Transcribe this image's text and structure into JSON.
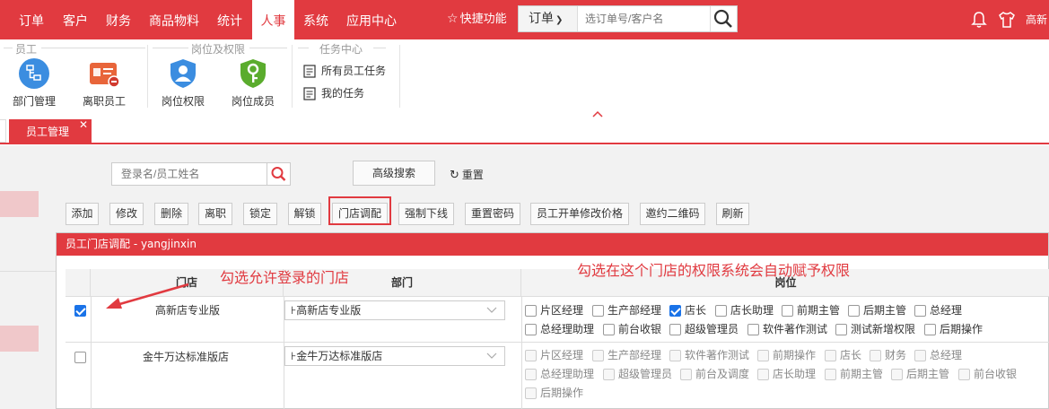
{
  "topnav": {
    "items": [
      {
        "label": "订单",
        "active": false
      },
      {
        "label": "客户",
        "active": false
      },
      {
        "label": "财务",
        "active": false
      },
      {
        "label": "商品物料",
        "active": false
      },
      {
        "label": "统计",
        "active": false
      },
      {
        "label": "人事",
        "active": true
      },
      {
        "label": "系统",
        "active": false
      },
      {
        "label": "应用中心",
        "active": false
      }
    ],
    "quick_label": "快捷功能",
    "search_scope": "订单",
    "search_placeholder": "选订单号/客户名",
    "user_name": "高新"
  },
  "ribbon": {
    "groups": [
      {
        "title": "员工",
        "buttons": [
          {
            "label": "部门管理",
            "icon": "org-chart-icon"
          },
          {
            "label": "离职员工",
            "icon": "resign-card-icon"
          }
        ]
      },
      {
        "title": "岗位及权限",
        "buttons": [
          {
            "label": "岗位权限",
            "icon": "user-shield-icon"
          },
          {
            "label": "岗位成员",
            "icon": "key-shield-icon"
          }
        ]
      },
      {
        "title": "任务中心",
        "items": [
          {
            "label": "所有员工任务"
          },
          {
            "label": "我的任务"
          }
        ]
      }
    ]
  },
  "tabs": [
    {
      "label": "员工管理",
      "active": true
    }
  ],
  "filter": {
    "name_placeholder": "登录名/员工姓名",
    "advanced_label": "高级搜索",
    "reset_label": "重置"
  },
  "toolbar": [
    "添加",
    "修改",
    "删除",
    "离职",
    "锁定",
    "解锁",
    "门店调配",
    "强制下线",
    "重置密码",
    "员工开单修改价格",
    "邀约二维码",
    "刷新"
  ],
  "dialog": {
    "title": "员工门店调配 - yangjinxin",
    "columns": {
      "store": "门店",
      "dept": "部门",
      "roles": "岗位"
    },
    "rows": [
      {
        "checked": true,
        "store": "高新店专业版",
        "dept": "⊦高新店专业版",
        "roles_enabled": true,
        "roles": [
          [
            {
              "label": "片区经理",
              "checked": false
            },
            {
              "label": "生产部经理",
              "checked": false
            },
            {
              "label": "店长",
              "checked": true
            },
            {
              "label": "店长助理",
              "checked": false
            },
            {
              "label": "前期主管",
              "checked": false
            },
            {
              "label": "后期主管",
              "checked": false
            },
            {
              "label": "总经理",
              "checked": false
            }
          ],
          [
            {
              "label": "总经理助理",
              "checked": false
            },
            {
              "label": "前台收银",
              "checked": false
            },
            {
              "label": "超级管理员",
              "checked": false
            },
            {
              "label": "软件著作测试",
              "checked": false
            },
            {
              "label": "测试新增权限",
              "checked": false
            },
            {
              "label": "后期操作",
              "checked": false
            }
          ]
        ]
      },
      {
        "checked": false,
        "store": "金牛万达标准版店",
        "dept": "⊦金牛万达标准版店",
        "roles_enabled": false,
        "roles": [
          [
            {
              "label": "片区经理",
              "checked": false
            },
            {
              "label": "生产部经理",
              "checked": false
            },
            {
              "label": "软件著作测试",
              "checked": false
            },
            {
              "label": "前期操作",
              "checked": false
            },
            {
              "label": "店长",
              "checked": false
            },
            {
              "label": "财务",
              "checked": false
            },
            {
              "label": "总经理",
              "checked": false
            }
          ],
          [
            {
              "label": "总经理助理",
              "checked": false
            },
            {
              "label": "超级管理员",
              "checked": false
            },
            {
              "label": "前台及调度",
              "checked": false
            },
            {
              "label": "店长助理",
              "checked": false
            },
            {
              "label": "前期主管",
              "checked": false
            },
            {
              "label": "后期主管",
              "checked": false
            },
            {
              "label": "前台收银",
              "checked": false
            }
          ],
          [
            {
              "label": "后期操作",
              "checked": false
            }
          ]
        ]
      }
    ]
  },
  "annotations": {
    "left": "勾选允许登录的门店",
    "right": "勾选在这个门店的权限系统会自动赋予权限"
  },
  "colors": {
    "brand_red": "#e13a40",
    "check_blue": "#1a73e8"
  }
}
